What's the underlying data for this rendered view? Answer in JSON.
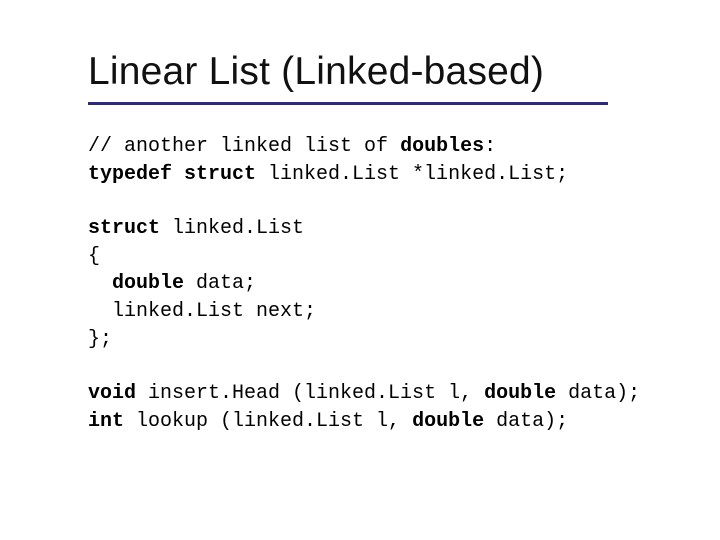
{
  "title": "Linear List (Linked-based)",
  "code": {
    "l1a": "// another linked list of ",
    "l1b": "doubles",
    "l1c": ":",
    "l2a": "typedef struct",
    "l2b": " linked.List *linked.List;",
    "l3a": "struct",
    "l3b": " linked.List",
    "l4": "{",
    "l5a": "  double",
    "l5b": " data;",
    "l6": "  linked.List next;",
    "l7": "};",
    "l8a": "void",
    "l8b": " insert.Head (linked.List l, ",
    "l8c": "double",
    "l8d": " data);",
    "l9a": "int",
    "l9b": " lookup (linked.List l, ",
    "l9c": "double",
    "l9d": " data);"
  }
}
